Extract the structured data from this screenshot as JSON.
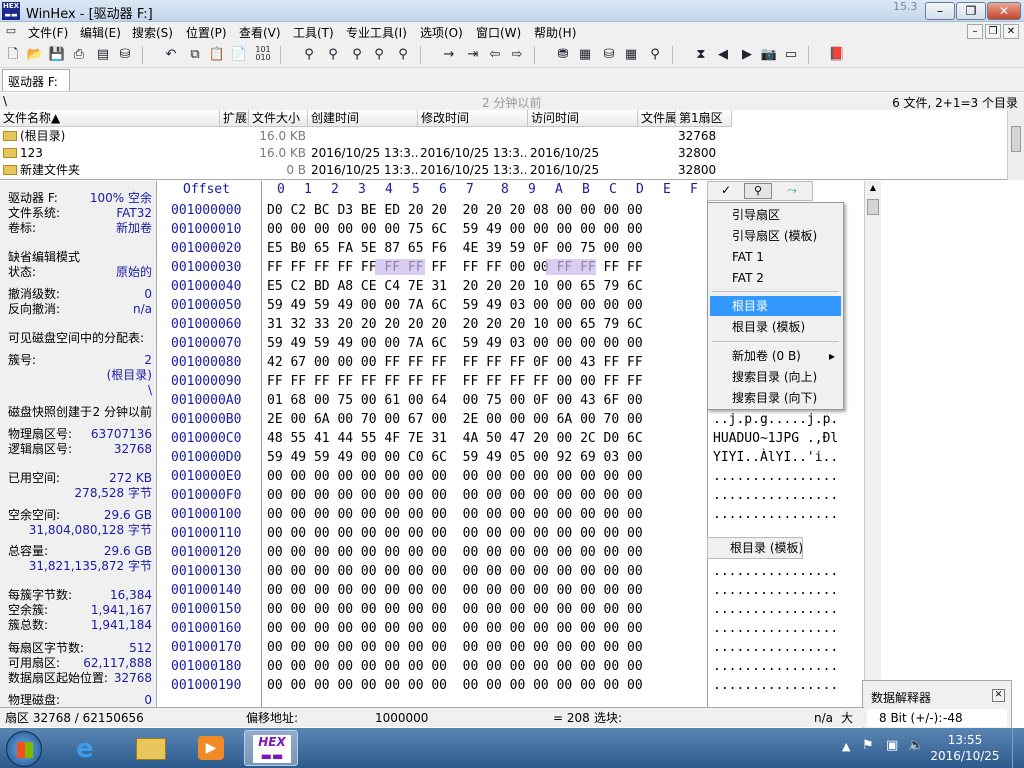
{
  "window": {
    "title": "WinHex - [驱动器 F:]",
    "version": "15.3",
    "buttons": {
      "minimize": "–",
      "maximize": "❐",
      "close": "✕"
    }
  },
  "menu": [
    "文件(F)",
    "编辑(E)",
    "搜索(S)",
    "位置(P)",
    "查看(V)",
    "工具(T)",
    "专业工具(I)",
    "选项(O)",
    "窗口(W)",
    "帮助(H)"
  ],
  "tab": {
    "label": "驱动器 F:"
  },
  "pathbar": {
    "path": "\\",
    "age": "2 分钟以前",
    "summary": "6 文件, 2+1=3 个目录"
  },
  "filelist": {
    "headers": [
      "文件名称▲",
      "扩展名",
      "文件大小",
      "创建时间",
      "修改时间",
      "访问时间",
      "文件属性",
      "第1扇区"
    ],
    "rows": [
      {
        "name": "(根目录)",
        "size": "16.0 KB",
        "created": "",
        "modified": "",
        "accessed": "",
        "sector": "32768"
      },
      {
        "name": "123",
        "size": "16.0 KB",
        "created": "2016/10/25  13:3...",
        "modified": "2016/10/25  13:3...",
        "accessed": "2016/10/25",
        "sector": "32800"
      },
      {
        "name": "新建文件夹",
        "size": "0 B",
        "created": "2016/10/25  13:3...",
        "modified": "2016/10/25  13:3...",
        "accessed": "2016/10/25",
        "sector": "32800"
      }
    ]
  },
  "info": {
    "drive_label": "驱动器 F:",
    "drive_value": "100% 空余",
    "fs_label": "文件系统:",
    "fs_value": "FAT32",
    "vol_label": "卷标:",
    "vol_value": "新加卷",
    "edit_mode": "缺省编辑模式",
    "state_label": "状态:",
    "state_value": "原始的",
    "undo_label": "撤消级数:",
    "undo_value": "0",
    "redo_label": "反向撤消:",
    "redo_value": "n/a",
    "alloc_title": "可见磁盘空间中的分配表:",
    "cluster_label": "簇号:",
    "cluster_value": "2",
    "cluster_sub": "(根目录)",
    "cluster_sub2": "\\",
    "snapshot_label": "磁盘快照创建于",
    "snapshot_value": "2 分钟以前",
    "phys_label": "物理扇区号:",
    "phys_value": "63707136",
    "logic_label": "逻辑扇区号:",
    "logic_value": "32768",
    "used_label": "已用空间:",
    "used_value": "272 KB",
    "used_bytes": "278,528 字节",
    "free_label": "空余空间:",
    "free_value": "29.6 GB",
    "free_bytes": "31,804,080,128 字节",
    "total_label": "总容量:",
    "total_value": "29.6 GB",
    "total_bytes": "31,821,135,872 字节",
    "bpc_label": "每簇字节数:",
    "bpc_value": "16,384",
    "freec_label": "空余簇:",
    "freec_value": "1,941,167",
    "totalc_label": "簇总数:",
    "totalc_value": "1,941,184",
    "bps_label": "每扇区字节数:",
    "bps_value": "512",
    "avail_label": "可用扇区:",
    "avail_value": "62,117,888",
    "dstart_label": "数据扇区起始位置:",
    "dstart_value": "32768",
    "physdisk_label": "物理磁盘:",
    "physdisk_value": "0"
  },
  "hex": {
    "offset_label": "Offset",
    "columns": [
      "0",
      "1",
      "2",
      "3",
      "4",
      "5",
      "6",
      "7",
      "8",
      "9",
      "A",
      "B",
      "C",
      "D",
      "E",
      "F"
    ],
    "rows": [
      {
        "off": "001000000",
        "bytes": "D0 C2 BC D3 BE ED 20 20  20 20 20 08 00 00 00 00",
        "ascii": ""
      },
      {
        "off": "001000010",
        "bytes": "00 00 00 00 00 00 75 6C  59 49 00 00 00 00 00 00",
        "ascii": ""
      },
      {
        "off": "001000020",
        "bytes": "E5 B0 65 FA 5E 87 65 F6  4E 39 59 0F 00 75 00 00",
        "ascii": ""
      },
      {
        "off": "001000030",
        "bytes": "FF FF FF FF FF FF FF FF  FF FF 00 00 FF FF FF FF",
        "ascii": "ÿÿ"
      },
      {
        "off": "001000040",
        "bytes": "E5 C2 BD A8 CE C4 7E 31  20 20 20 10 00 65 79 6C",
        "ascii": "yl"
      },
      {
        "off": "001000050",
        "bytes": "59 49 59 49 00 00 7A 6C  59 49 03 00 00 00 00 00",
        "ascii": ""
      },
      {
        "off": "001000060",
        "bytes": "31 32 33 20 20 20 20 20  20 20 20 10 00 65 79 6C",
        "ascii": "yl"
      },
      {
        "off": "001000070",
        "bytes": "59 49 59 49 00 00 7A 6C  59 49 03 00 00 00 00 00",
        "ascii": ""
      },
      {
        "off": "001000080",
        "bytes": "42 67 00 00 00 FF FF FF  FF FF FF 0F 00 43 FF FF",
        "ascii": "ÿÿ"
      },
      {
        "off": "001000090",
        "bytes": "FF FF FF FF FF FF FF FF  FF FF FF FF 00 00 FF FF",
        "ascii": "ÿÿ"
      },
      {
        "off": "0010000A0",
        "bytes": "01 68 00 75 00 61 00 64  00 75 00 0F 00 43 6F 00",
        "ascii": ""
      },
      {
        "off": "0010000B0",
        "bytes": "2E 00 6A 00 70 00 67 00  2E 00 00 00 6A 00 70 00",
        "ascii": "..j.p.g.....j.p."
      },
      {
        "off": "0010000C0",
        "bytes": "48 55 41 44 55 4F 7E 31  4A 50 47 20 00 2C D0 6C",
        "ascii": "HUADUO~1JPG .,Ðl"
      },
      {
        "off": "0010000D0",
        "bytes": "59 49 59 49 00 00 C0 6C  59 49 05 00 92 69 03 00",
        "ascii": "YIYI..ÀlYI..'i.."
      },
      {
        "off": "0010000E0",
        "bytes": "00 00 00 00 00 00 00 00  00 00 00 00 00 00 00 00",
        "ascii": "................"
      },
      {
        "off": "0010000F0",
        "bytes": "00 00 00 00 00 00 00 00  00 00 00 00 00 00 00 00",
        "ascii": "................"
      },
      {
        "off": "001000100",
        "bytes": "00 00 00 00 00 00 00 00  00 00 00 00 00 00 00 00",
        "ascii": "................"
      },
      {
        "off": "001000110",
        "bytes": "00 00 00 00 00 00 00 00  00 00 00 00 00 00 00 00",
        "ascii": ""
      },
      {
        "off": "001000120",
        "bytes": "00 00 00 00 00 00 00 00  00 00 00 00 00 00 00 00",
        "ascii": ""
      },
      {
        "off": "001000130",
        "bytes": "00 00 00 00 00 00 00 00  00 00 00 00 00 00 00 00",
        "ascii": "................"
      },
      {
        "off": "001000140",
        "bytes": "00 00 00 00 00 00 00 00  00 00 00 00 00 00 00 00",
        "ascii": "................"
      },
      {
        "off": "001000150",
        "bytes": "00 00 00 00 00 00 00 00  00 00 00 00 00 00 00 00",
        "ascii": "................"
      },
      {
        "off": "001000160",
        "bytes": "00 00 00 00 00 00 00 00  00 00 00 00 00 00 00 00",
        "ascii": "................"
      },
      {
        "off": "001000170",
        "bytes": "00 00 00 00 00 00 00 00  00 00 00 00 00 00 00 00",
        "ascii": "................"
      },
      {
        "off": "001000180",
        "bytes": "00 00 00 00 00 00 00 00  00 00 00 00 00 00 00 00",
        "ascii": "................"
      },
      {
        "off": "001000190",
        "bytes": "00 00 00 00 00 00 00 00  00 00 00 00 00 00 00 00",
        "ascii": "................"
      }
    ]
  },
  "popup": {
    "items": [
      "引导扇区",
      "引导扇区 (模板)",
      "FAT 1",
      "FAT 2",
      "根目录",
      "根目录 (模板)",
      "新加卷 (0 B)",
      "搜索目录 (向上)",
      "搜索目录 (向下)"
    ],
    "submenu_arrow": "▸",
    "tooltip": "根目录 (模板)"
  },
  "statusbar": {
    "sector": "扇区 32768 / 62150656",
    "offset_label": "偏移地址:",
    "offset_value": "1000000",
    "value": "= 208",
    "block_label": "选块:",
    "na": "n/a",
    "size_label": "大小"
  },
  "interpreter": {
    "title": "数据解释器",
    "row": "8 Bit (+/-):",
    "row_value": "-48"
  },
  "clock": {
    "time": "13:55",
    "date": "2016/10/25"
  },
  "colors": {
    "accent": "#3399ff",
    "hex_blue": "#1a1aa8",
    "highlight": "#c9b8ef"
  }
}
